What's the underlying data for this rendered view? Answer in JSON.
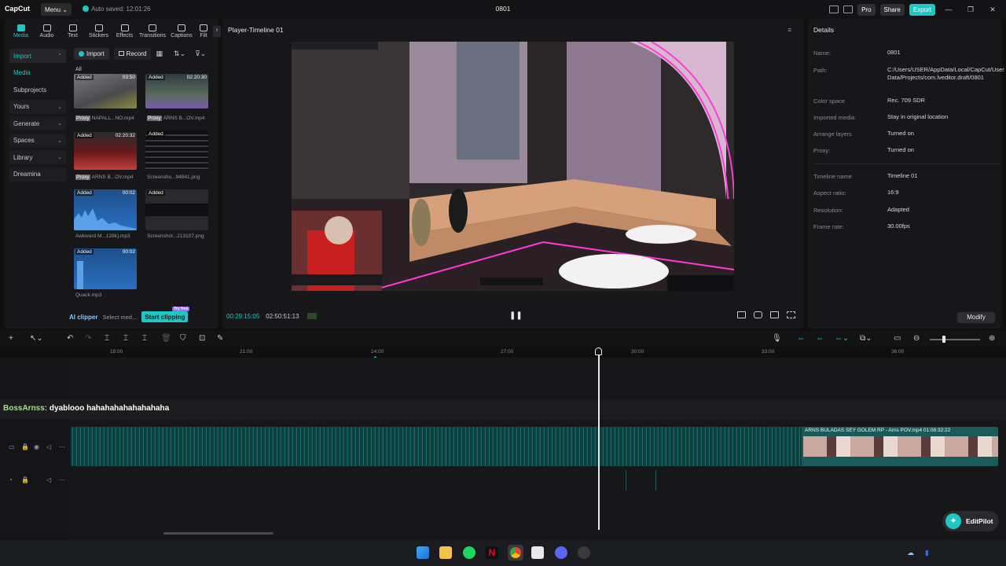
{
  "app": {
    "logo": "CapCut",
    "menu": "Menu",
    "autosave": "Auto saved: 12:01:26",
    "title": "0801",
    "pro": "Pro",
    "share": "Share",
    "export": "Export"
  },
  "toptabs": [
    "Media",
    "Audio",
    "Text",
    "Stickers",
    "Effects",
    "Transitions",
    "Captions",
    "Filt"
  ],
  "sidenav": [
    "Import",
    "Media",
    "Subprojects",
    "Yours",
    "Generate",
    "Spaces",
    "Library",
    "Dreamina"
  ],
  "media_tools": {
    "import": "Import",
    "record": "Record",
    "all": "All"
  },
  "media_items": [
    {
      "tag": "Added",
      "dur": "03:50",
      "name": "NAPALL...NO.mp4",
      "proxy": "Proxy"
    },
    {
      "tag": "Added",
      "dur": "02:20:30",
      "name": "ARNS B...OV.mp4",
      "proxy": "Proxy"
    },
    {
      "tag": "Added",
      "dur": "02:20:32",
      "name": "ARNS B...OV.mp4",
      "proxy": "Proxy"
    },
    {
      "tag": "Added",
      "dur": "",
      "name": "Screensho...94841.png",
      "proxy": ""
    },
    {
      "tag": "Added",
      "dur": "00:02",
      "name": "Awkward M...128k).mp3",
      "proxy": ""
    },
    {
      "tag": "Added",
      "dur": "",
      "name": "Screenshot...213107.png",
      "proxy": ""
    },
    {
      "tag": "Added",
      "dur": "00:02",
      "name": "Quack.mp3",
      "proxy": ""
    }
  ],
  "ai": {
    "clipper": "AI clipper",
    "select": "Select med...",
    "start": "Start clipping",
    "badge": "Try free"
  },
  "player": {
    "title": "Player-Timeline 01",
    "current": "00:29:15:05",
    "total": "02:50:51:13"
  },
  "details": {
    "title": "Details",
    "rows": [
      {
        "k": "Name:",
        "v": "0801"
      },
      {
        "k": "Path:",
        "v": "C:/Users/USER/AppData/Local/CapCut/User Data/Projects/com.lveditor.draft/0801"
      },
      {
        "k": "Color space",
        "v": "Rec. 709 SDR"
      },
      {
        "k": "Imported media:",
        "v": "Stay in original location"
      },
      {
        "k": "Arrange layers",
        "v": "Turned on"
      },
      {
        "k": "Proxy:",
        "v": "Turned on"
      },
      {
        "k": "Timeline name",
        "v": "Timeline 01"
      },
      {
        "k": "Aspect ratio:",
        "v": "16:9"
      },
      {
        "k": "Resolution:",
        "v": "Adapted"
      },
      {
        "k": "Frame rate:",
        "v": "30.00fps"
      }
    ],
    "modify": "Modify"
  },
  "ruler": [
    "18:00",
    "21:00",
    "24:00",
    "27:00",
    "30:00",
    "33:00",
    "36:00"
  ],
  "timeline": {
    "overlay_user": "BossArnss:",
    "overlay_msg": " dyablooo hahahahahahahahaha",
    "clip2": "ARNS BULADAS SEY GOLEM RP - Arns POV.mp4   01:08:32:22"
  },
  "editpilot": "EditPilot",
  "colors": {
    "accent": "#1fc7c4",
    "track": "#124e4e"
  }
}
